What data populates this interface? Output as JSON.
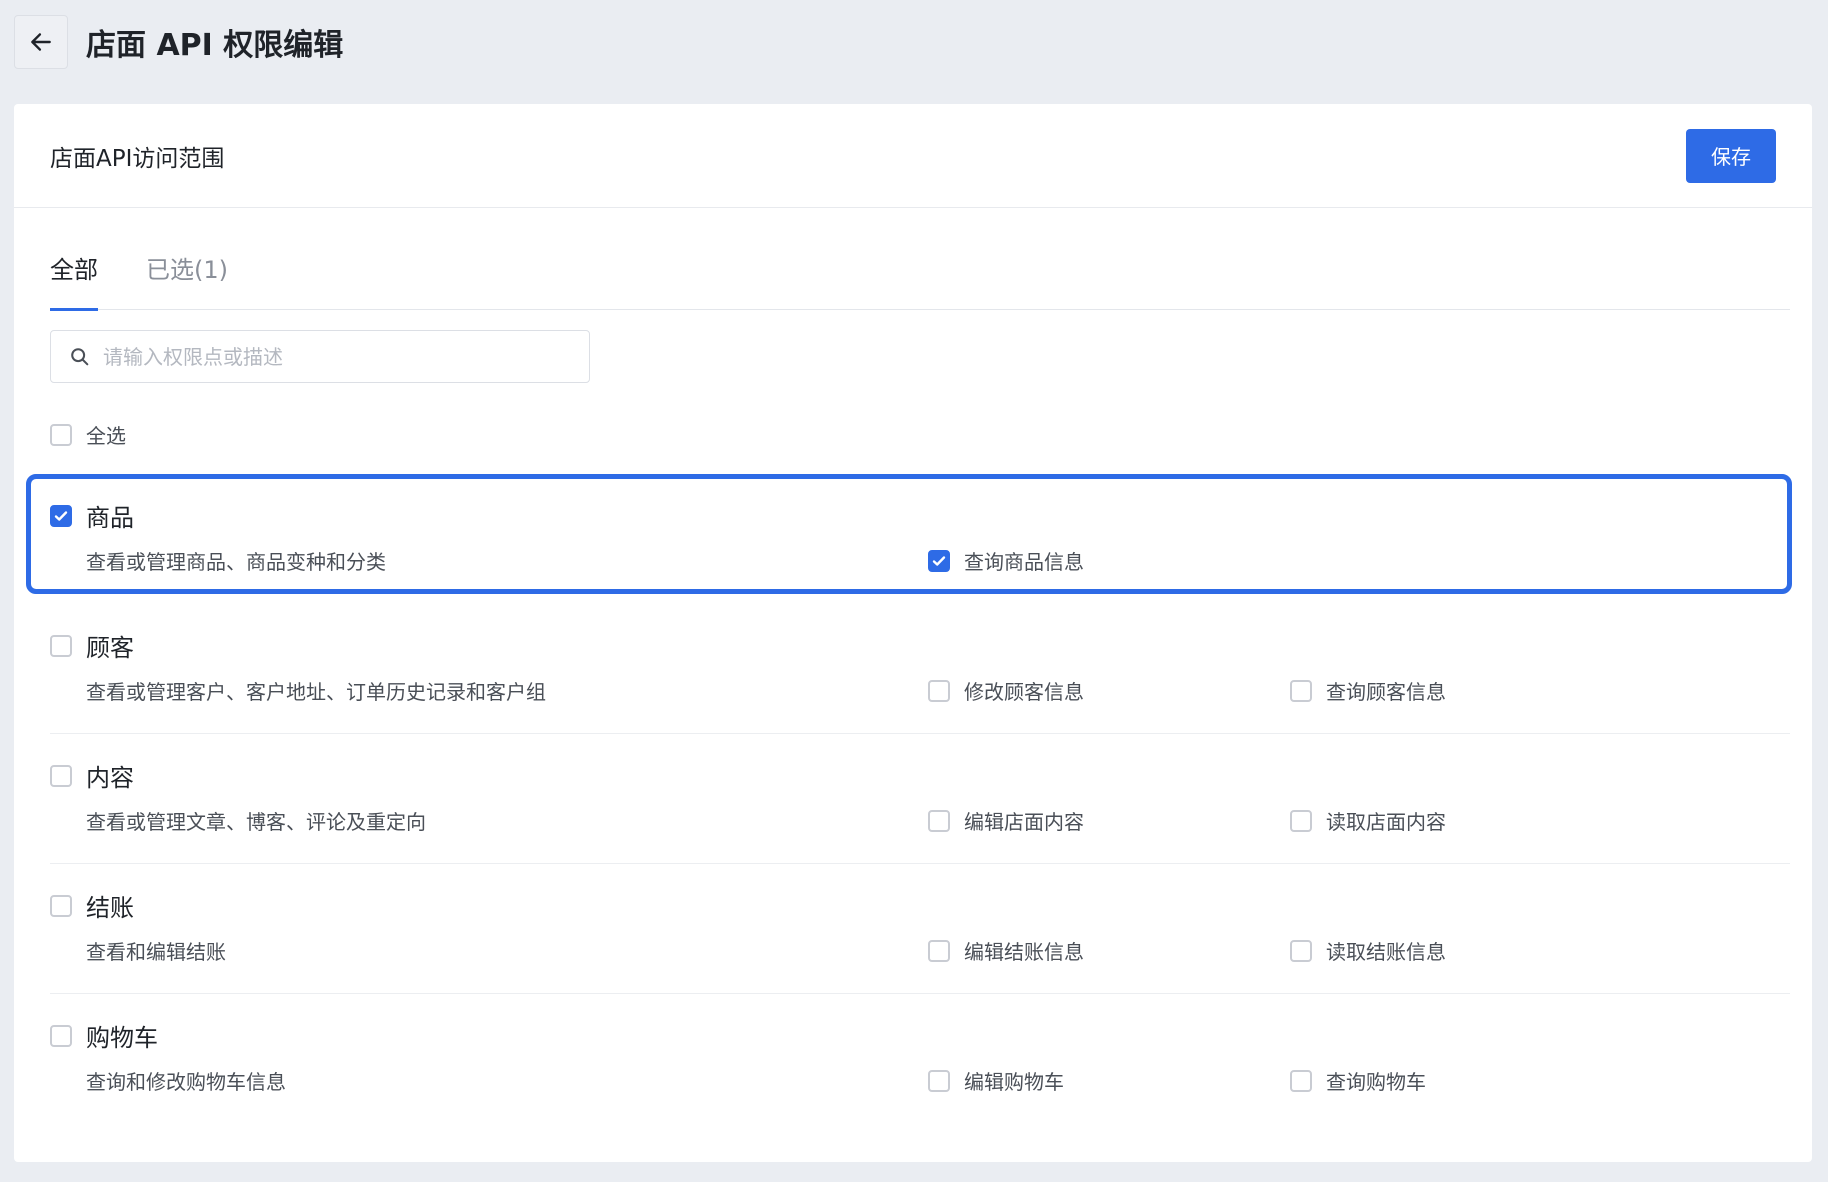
{
  "header": {
    "back_label": "←",
    "title": "店面 API 权限编辑"
  },
  "card": {
    "title": "店面API访问范围",
    "save_label": "保存"
  },
  "tabs": [
    {
      "label": "全部",
      "active": true
    },
    {
      "label": "已选(1)",
      "active": false
    }
  ],
  "search": {
    "placeholder": "请输入权限点或描述",
    "value": ""
  },
  "select_all": {
    "label": "全选",
    "checked": false
  },
  "groups": [
    {
      "name": "商品",
      "description": "查看或管理商品、商品变种和分类",
      "checked": true,
      "permissions": [
        {
          "label": "查询商品信息",
          "checked": true
        }
      ]
    },
    {
      "name": "顾客",
      "description": "查看或管理客户、客户地址、订单历史记录和客户组",
      "checked": false,
      "permissions": [
        {
          "label": "修改顾客信息",
          "checked": false
        },
        {
          "label": "查询顾客信息",
          "checked": false
        }
      ]
    },
    {
      "name": "内容",
      "description": "查看或管理文章、博客、评论及重定向",
      "checked": false,
      "permissions": [
        {
          "label": "编辑店面内容",
          "checked": false
        },
        {
          "label": "读取店面内容",
          "checked": false
        }
      ]
    },
    {
      "name": "结账",
      "description": "查看和编辑结账",
      "checked": false,
      "permissions": [
        {
          "label": "编辑结账信息",
          "checked": false
        },
        {
          "label": "读取结账信息",
          "checked": false
        }
      ]
    },
    {
      "name": "购物车",
      "description": "查询和修改购物车信息",
      "checked": false,
      "permissions": [
        {
          "label": "编辑购物车",
          "checked": false
        },
        {
          "label": "查询购物车",
          "checked": false
        }
      ]
    }
  ],
  "colors": {
    "accent": "#2e6be6",
    "background": "#eaedf2"
  }
}
